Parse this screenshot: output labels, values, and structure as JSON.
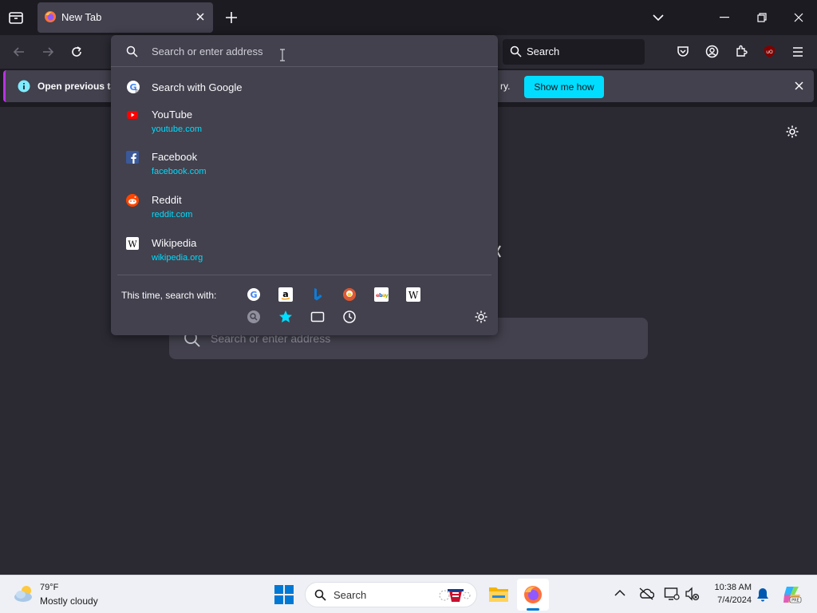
{
  "browser": {
    "tab": {
      "title": "New Tab"
    },
    "toolbar_search": {
      "placeholder": "Search"
    }
  },
  "notification": {
    "message_start": "Open previous tab",
    "message_end": "ry.",
    "button": "Show me how"
  },
  "urlbar": {
    "placeholder": "Search or enter address",
    "results": [
      {
        "title": "Search with Google",
        "url": "",
        "icon": "google-icon"
      },
      {
        "title": "YouTube",
        "url": "youtube.com",
        "icon": "youtube-icon"
      },
      {
        "title": "Facebook",
        "url": "facebook.com",
        "icon": "facebook-icon"
      },
      {
        "title": "Reddit",
        "url": "reddit.com",
        "icon": "reddit-icon"
      },
      {
        "title": "Wikipedia",
        "url": "wikipedia.org",
        "icon": "wikipedia-icon"
      }
    ],
    "oneoff_label": "This time, search with:",
    "engines": [
      "google-icon",
      "amazon-icon",
      "bing-icon",
      "duckduckgo-icon",
      "ebay-icon",
      "wikipedia-icon",
      "search-tabs-icon",
      "bookmarks-icon",
      "tabs-icon",
      "history-icon"
    ]
  },
  "page": {
    "search_placeholder": "Search or enter address"
  },
  "taskbar": {
    "weather_temp": "79°F",
    "weather_desc": "Mostly cloudy",
    "search_placeholder": "Search",
    "time": "10:38 AM",
    "date": "7/4/2024"
  },
  "colors": {
    "accent": "#00ddff",
    "background": "#1c1b22",
    "panel": "#42414d",
    "toolbar": "#2b2a33"
  }
}
